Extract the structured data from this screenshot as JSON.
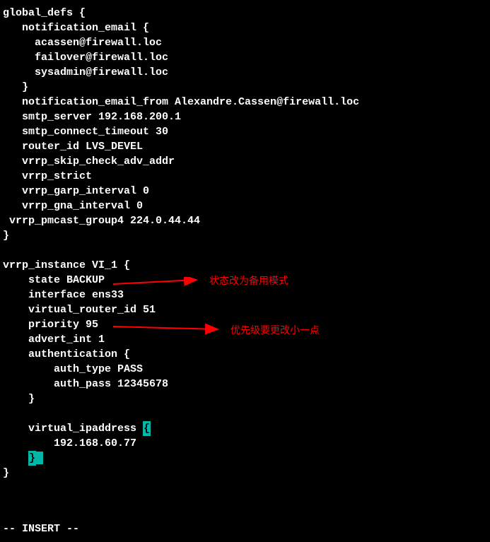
{
  "config": {
    "lines": [
      "global_defs {",
      "   notification_email {",
      "     acassen@firewall.loc",
      "     failover@firewall.loc",
      "     sysadmin@firewall.loc",
      "   }",
      "   notification_email_from Alexandre.Cassen@firewall.loc",
      "   smtp_server 192.168.200.1",
      "   smtp_connect_timeout 30",
      "   router_id LVS_DEVEL",
      "   vrrp_skip_check_adv_addr",
      "   vrrp_strict",
      "   vrrp_garp_interval 0",
      "   vrrp_gna_interval 0",
      " vrrp_pmcast_group4 224.0.44.44",
      "}",
      "",
      "vrrp_instance VI_1 {",
      "    state BACKUP",
      "    interface ens33",
      "    virtual_router_id 51",
      "    priority 95",
      "    advert_int 1",
      "    authentication {",
      "        auth_type PASS",
      "        auth_pass 12345678",
      "    }",
      "",
      "    virtual_ipaddress ",
      "        192.168.60.77",
      "    ",
      "}"
    ],
    "open_brace": "{",
    "close_brace": "}"
  },
  "annotations": {
    "state_note": "状态改为备用模式",
    "priority_note": "优先级要更改小一点"
  },
  "mode": "-- INSERT --"
}
